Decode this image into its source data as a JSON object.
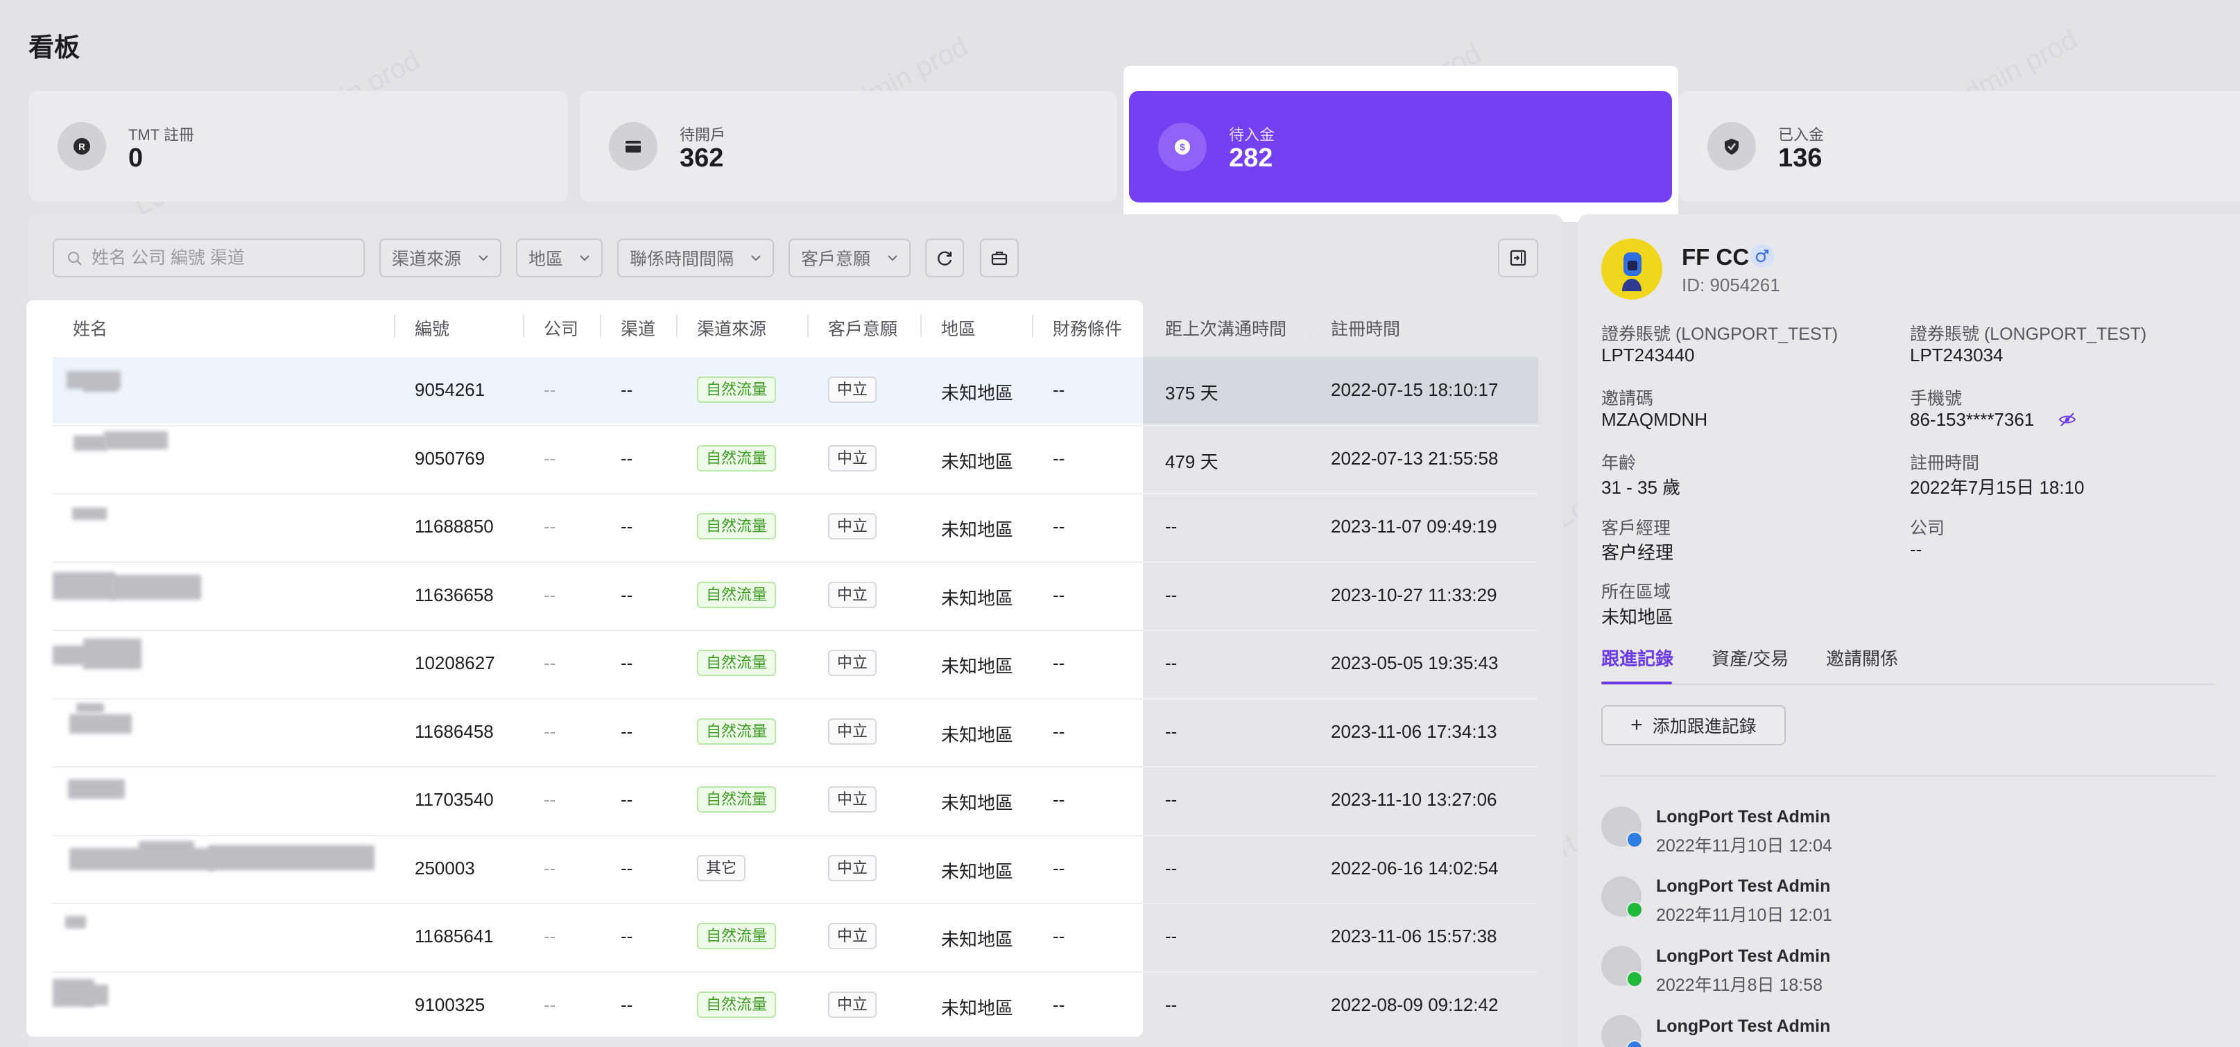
{
  "page": {
    "title": "看板"
  },
  "stats": [
    {
      "label": "TMT 註冊",
      "value": "0",
      "icon": "registered-icon"
    },
    {
      "label": "待開戶",
      "value": "362",
      "icon": "card-icon"
    },
    {
      "label": "待入金",
      "value": "282",
      "icon": "dollar-coin-icon"
    },
    {
      "label": "已入金",
      "value": "136",
      "icon": "shield-check-icon"
    }
  ],
  "filters": {
    "search_placeholder": "姓名 公司 編號 渠道",
    "channel_source": "渠道來源",
    "region": "地區",
    "contact_interval": "聯係時間間隔",
    "customer_intent": "客戶意願"
  },
  "table": {
    "columns": [
      "姓名",
      "編號",
      "公司",
      "渠道",
      "渠道來源",
      "客戶意願",
      "地區",
      "財務條件",
      "距上次溝通時間",
      "註冊時間"
    ],
    "rows": [
      {
        "id": "9054261",
        "company": "--",
        "channel": "--",
        "source": "自然流量",
        "intent": "中立",
        "region": "未知地區",
        "finance": "--",
        "last_contact": "375 天",
        "registered": "2022-07-15 18:10:17"
      },
      {
        "id": "9050769",
        "company": "--",
        "channel": "--",
        "source": "自然流量",
        "intent": "中立",
        "region": "未知地區",
        "finance": "--",
        "last_contact": "479 天",
        "registered": "2022-07-13 21:55:58"
      },
      {
        "id": "11688850",
        "company": "--",
        "channel": "--",
        "source": "自然流量",
        "intent": "中立",
        "region": "未知地區",
        "finance": "--",
        "last_contact": "--",
        "registered": "2023-11-07 09:49:19"
      },
      {
        "id": "11636658",
        "company": "--",
        "channel": "--",
        "source": "自然流量",
        "intent": "中立",
        "region": "未知地區",
        "finance": "--",
        "last_contact": "--",
        "registered": "2023-10-27 11:33:29"
      },
      {
        "id": "10208627",
        "company": "--",
        "channel": "--",
        "source": "自然流量",
        "intent": "中立",
        "region": "未知地區",
        "finance": "--",
        "last_contact": "--",
        "registered": "2023-05-05 19:35:43"
      },
      {
        "id": "11686458",
        "company": "--",
        "channel": "--",
        "source": "自然流量",
        "intent": "中立",
        "region": "未知地區",
        "finance": "--",
        "last_contact": "--",
        "registered": "2023-11-06 17:34:13"
      },
      {
        "id": "11703540",
        "company": "--",
        "channel": "--",
        "source": "自然流量",
        "intent": "中立",
        "region": "未知地區",
        "finance": "--",
        "last_contact": "--",
        "registered": "2023-11-10 13:27:06"
      },
      {
        "id": "250003",
        "company": "--",
        "channel": "--",
        "source": "其它",
        "intent": "中立",
        "region": "未知地區",
        "finance": "--",
        "last_contact": "--",
        "registered": "2022-06-16 14:02:54"
      },
      {
        "id": "11685641",
        "company": "--",
        "channel": "--",
        "source": "自然流量",
        "intent": "中立",
        "region": "未知地區",
        "finance": "--",
        "last_contact": "--",
        "registered": "2023-11-06 15:57:38"
      },
      {
        "id": "9100325",
        "company": "--",
        "channel": "--",
        "source": "自然流量",
        "intent": "中立",
        "region": "未知地區",
        "finance": "--",
        "last_contact": "--",
        "registered": "2022-08-09 09:12:42"
      }
    ]
  },
  "detail": {
    "name": "FF CC",
    "id_text": "ID: 9054261",
    "fields": [
      {
        "label": "證券賬號 (LONGPORT_TEST)",
        "value": "LPT243440"
      },
      {
        "label": "證券賬號 (LONGPORT_TEST)",
        "value": "LPT243034"
      },
      {
        "label": "邀請碼",
        "value": "MZAQMDNH"
      },
      {
        "label": "手機號",
        "value": "86-153****7361"
      },
      {
        "label": "年齡",
        "value": "31 - 35 歲"
      },
      {
        "label": "註冊時間",
        "value": "2022年7月15日 18:10"
      },
      {
        "label": "客戶經理",
        "value": "客户经理"
      },
      {
        "label": "公司",
        "value": "--"
      },
      {
        "label": "所在區域",
        "value": "未知地區"
      }
    ],
    "tabs": [
      "跟進記錄",
      "資產/交易",
      "邀請關係"
    ],
    "add_button": "添加跟進記錄",
    "logs": [
      {
        "name": "LongPort Test Admin",
        "time": "2022年11月10日 12:04",
        "badge_color": "#2f7de1"
      },
      {
        "name": "LongPort Test Admin",
        "time": "2022年11月10日 12:01",
        "badge_color": "#1fb83a"
      },
      {
        "name": "LongPort Test Admin",
        "time": "2022年11月8日 18:58",
        "badge_color": "#1fb83a"
      },
      {
        "name": "LongPort Test Admin",
        "time": "",
        "badge_color": "#2f7de1"
      }
    ]
  },
  "watermark": "LongPort Test Admin prod",
  "colors": {
    "accent": "#7540f2",
    "tag_green": "#3b9a22",
    "tab_active": "#6a3ae6"
  }
}
